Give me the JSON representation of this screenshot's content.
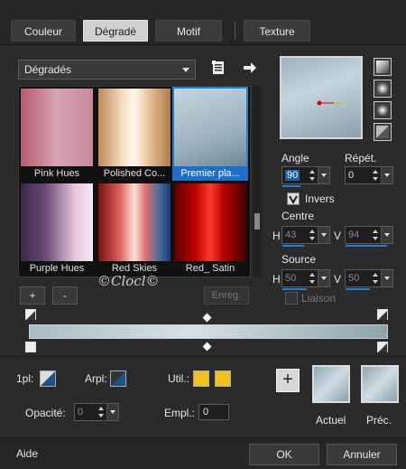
{
  "tabs": [
    {
      "label": "Couleur",
      "active": false
    },
    {
      "label": "Dégradé",
      "active": true
    },
    {
      "label": "Motif",
      "active": false
    },
    {
      "label": "Texture",
      "active": false
    }
  ],
  "library": {
    "dropdown_value": "Dégradés",
    "items": [
      {
        "label": "Pink Hues",
        "selected": false
      },
      {
        "label": "Polished Co...",
        "selected": false
      },
      {
        "label": "Premier pla...",
        "selected": true
      },
      {
        "label": "Purple Hues",
        "selected": false
      },
      {
        "label": "Red Skies",
        "selected": false
      },
      {
        "label": "Red_ Satin",
        "selected": false
      }
    ],
    "add_label": "+",
    "remove_label": "-",
    "save_label": "Enreg."
  },
  "watermark": "©Clocl©",
  "settings": {
    "angle_label": "Angle",
    "angle_value": "90",
    "repeat_label": "Répét.",
    "repeat_value": "0",
    "invert_label": "Invers",
    "invert_checked": true,
    "center_label": "Centre",
    "center_h_label": "H",
    "center_h_value": "43",
    "center_v_label": "V",
    "center_v_value": "94",
    "source_label": "Source",
    "source_h_label": "H",
    "source_h_value": "50",
    "source_v_label": "V",
    "source_v_value": "50",
    "link_label": "Liaison",
    "link_checked": false
  },
  "stops": {
    "location_label": "1pl:",
    "background_label": "Arpl:",
    "util_label": "Util.:",
    "util_color_1": "#f2c21c",
    "util_color_2": "#f2c21c",
    "opacity_label": "Opacité:",
    "opacity_value": "0",
    "location_value_label": "Empl.:",
    "location_value": "0"
  },
  "swatches": {
    "current_label": "Actuel",
    "previous_label": "Préc."
  },
  "footer": {
    "help_label": "Aide",
    "ok_label": "OK",
    "cancel_label": "Annuler"
  },
  "colors": {
    "accent": "#1f7fd6",
    "background": "#2b2b2b",
    "yellow": "#f2c21c"
  }
}
